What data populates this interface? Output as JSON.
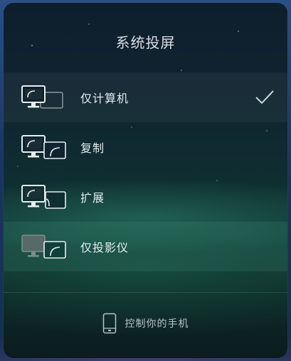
{
  "title": "系统投屏",
  "menu": {
    "items": [
      {
        "label": "仅计算机",
        "icon": "pc-only-icon",
        "selected": true
      },
      {
        "label": "复制",
        "icon": "duplicate-icon",
        "selected": false
      },
      {
        "label": "扩展",
        "icon": "extend-icon",
        "selected": false
      },
      {
        "label": "仅投影仪",
        "icon": "projector-only-icon",
        "selected": false
      }
    ],
    "selected_icon": "checkmark-icon"
  },
  "footer": {
    "label": "控制你的手机",
    "icon": "phone-icon"
  },
  "colors": {
    "panel_top": "#0f1e2c",
    "panel_mid": "#113c36",
    "text_primary": "#e4ecef",
    "text_secondary": "#b9c3c8",
    "accent_glow": "#46be96"
  }
}
